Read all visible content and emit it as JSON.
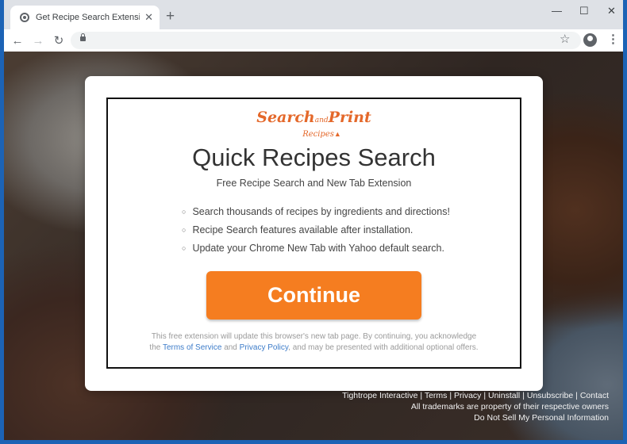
{
  "browser": {
    "tab_title": "Get Recipe Search Extension by T",
    "tab_close": "✕",
    "new_tab": "+",
    "minimize": "—",
    "maximize": "☐",
    "close": "✕",
    "back": "←",
    "forward": "→",
    "reload": "↻",
    "url": "",
    "star": "☆",
    "menu": "⋮"
  },
  "logo": {
    "word1": "Search",
    "word2": "and",
    "word3": "Print",
    "word4": "Recipes"
  },
  "headline": "Quick Recipes Search",
  "subheadline": "Free Recipe Search and New Tab Extension",
  "features": [
    "Search thousands of recipes by ingredients and directions!",
    "Recipe Search features available after installation.",
    "Update your Chrome New Tab with Yahoo default search."
  ],
  "cta_label": "Continue",
  "disclaimer": {
    "line1": "This free extension will update this browser's new tab page. By continuing, you acknowledge",
    "pre": "the",
    "terms": "Terms of Service",
    "and": "and",
    "privacy": "Privacy Policy",
    "post": ", and may be presented with additional optional offers."
  },
  "footer": {
    "links": [
      "Tightrope Interactive",
      "Terms",
      "Privacy",
      "Uninstall",
      "Unsubscribe",
      "Contact"
    ],
    "separator": "|",
    "line2": "All trademarks are property of their respective owners",
    "line3": "Do Not Sell My Personal Information"
  },
  "colors": {
    "accent": "#f57d20",
    "link": "#3d7cc9",
    "window_border": "#1c63b5"
  }
}
